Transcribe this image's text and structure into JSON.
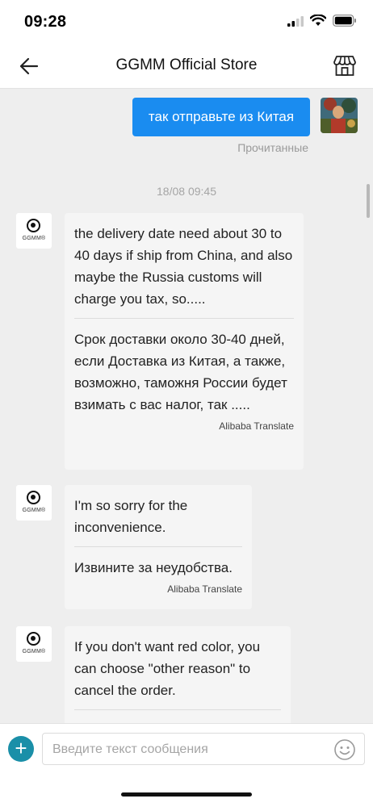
{
  "status_bar": {
    "time": "09:28",
    "icons": [
      "signal-icon",
      "wifi-icon",
      "battery-icon"
    ]
  },
  "header": {
    "title": "GGMM Official Store",
    "back_icon": "back-arrow-icon",
    "store_icon": "store-icon"
  },
  "conversation": {
    "outgoing": {
      "text": "так отправьте из Китая",
      "status": "Прочитанные"
    },
    "timestamp": "18/08 09:45",
    "store_logo_text": "GGMM®",
    "incoming": [
      {
        "original": "the delivery date need about 30 to 40 days if ship from China, and also maybe the Russia customs will charge you tax, so.....",
        "translation": "Срок доставки около 30-40 дней, если Доставка из Китая, а также, возможно, таможня России будет взимать с вас налог, так .....",
        "translate_label": "Alibaba Translate"
      },
      {
        "original": "I'm so sorry for the inconvenience.",
        "translation": "Извините за неудобства.",
        "translate_label": "Alibaba Translate"
      },
      {
        "original": "If you don't want red color, you can choose \"other reason\" to cancel the order."
      }
    ]
  },
  "composer": {
    "placeholder": "Введите текст сообщения",
    "plus_label": "+"
  },
  "colors": {
    "accent_blue": "#1a8cf0",
    "plus_teal": "#1a8fa8",
    "chat_bg": "#eeeeee"
  }
}
